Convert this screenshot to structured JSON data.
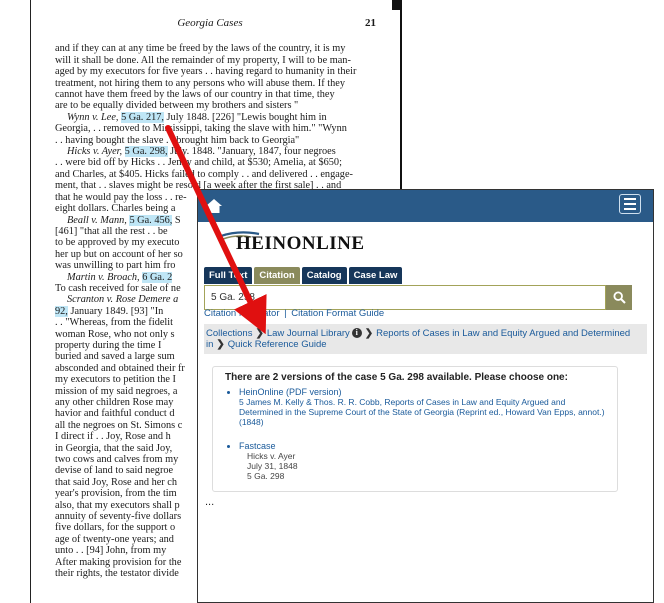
{
  "book_page": {
    "header_title": "Georgia Cases",
    "page_number": "21",
    "lines": [
      "and if they can at any time be freed by the laws of the country, it is my",
      "will it shall be done.  All the remainder of my property, I will to be man-",
      "aged by my executors for five years . . having regard to humanity in their",
      "treatment, not hiring them to any persons who will abuse them.  If they",
      "cannot have them freed by the laws of our country in that time, they",
      "are to be equally divided between my brothers and sisters \""
    ],
    "wynn_case": {
      "name": "Wynn v. Lee,",
      "cite": "5 Ga. 217,",
      "rest": " July 1848.  [226] \"Lewis bought him in"
    },
    "wynn_lines": [
      "Georgia, . . removed to Mississippi, taking the slave with him.\"  \"Wynn",
      ". . having bought the slave . . brought him back to Georgia\""
    ],
    "hicks_case": {
      "name": "Hicks v. Ayer,",
      "cite": "5 Ga. 298,",
      "rest": " July. 1848.  \"January, 1847, four negroes"
    },
    "hicks_lines": [
      ". . were bid off by Hicks . . Jenny and child, at $530; Amelia, at $650;",
      "and Charles, at $405.  Hicks failed to comply . . and delivered . . engage-",
      "ment, that . . slaves might be resold [a week after the first sale] . . and",
      "that he would pay the loss . . re-",
      "eight dollars.  Charles being a"
    ],
    "beall_case": {
      "name": "Beall v. Mann,",
      "cite": "5 Ga. 456,",
      "rest": " S"
    },
    "beall_lines": [
      "[461] \"that all the rest . . be",
      "to be approved by my executo",
      "her up but on account of her so",
      "was unwilling to part him fro"
    ],
    "martin_case": {
      "name": "Martin v. Broach,",
      "cite": "6 Ga. 2"
    },
    "martin_lines": [
      "To cash received for sale of ne"
    ],
    "scranton_case": {
      "name": "Scranton v. Rose Demere a"
    },
    "scranton_first": {
      "cite": "92,",
      "rest": " January 1849.  [93]  \"In"
    },
    "scranton_lines": [
      ". . \"Whereas, from the fidelit",
      "woman Rose, who not only s",
      "property during the time I",
      "buried and saved a large sum",
      "absconded and obtained their fr",
      "my executors to petition the I",
      "mission of my said negroes, a",
      "any other children Rose may",
      "havior and faithful conduct d",
      "all the negroes on St. Simons c",
      "I direct if . . Joy, Rose and h",
      "in Georgia, that the said Joy,",
      "two cows and calves from my",
      "devise of land to said negroe",
      "that said Joy, Rose and her ch",
      "year's provision, from the tim",
      "also, that my executors shall p",
      "annuity of seventy-five dollars",
      "five dollars, for the support o",
      "age of twenty-one years; and",
      "unto . . [94] John, from my",
      "After making provision for the",
      "their rights, the testator divide"
    ]
  },
  "heinonline": {
    "logo_text": "HEINONLINE",
    "tabs": [
      {
        "label": "Full Text",
        "active": false
      },
      {
        "label": "Citation",
        "active": true
      },
      {
        "label": "Catalog",
        "active": false
      },
      {
        "label": "Case Law",
        "active": false
      }
    ],
    "search": {
      "value": "5 Ga. 298"
    },
    "cite_links": {
      "navigator": "Citation Navigator",
      "separator": "|",
      "format_guide": "Citation Format Guide"
    },
    "breadcrumb": {
      "collections": "Collections",
      "library": "Law Journal Library",
      "reports": "Reports of Cases in Law and Equity Argued and Determined in",
      "quick_ref": "Quick Reference Guide"
    },
    "results": {
      "title": "There are 2 versions of the case 5 Ga. 298 available. Please choose one:",
      "v1_link": "HeinOnline (PDF version)",
      "v1_detail": "5 James M. Kelly & Thos. R. R. Cobb, Reports of Cases in Law and Equity Argued and Determined in the Supreme Court of the State of Georgia (Reprint ed., Howard Van Epps, annot.) (1848)",
      "v2_link": "Fastcase",
      "v2_case": "Hicks v. Ayer",
      "v2_date": "July 31, 1848",
      "v2_cite": "5 Ga. 298"
    },
    "ellipsis": "..."
  },
  "colors": {
    "topbar": "#2a5a88",
    "tab_dark": "#16365a",
    "tab_active": "#8a8a5c",
    "link": "#1a5a9a",
    "highlight": "#bfe6f6",
    "arrow": "#e01010"
  },
  "icons": {
    "home": "home-icon",
    "menu": "hamburger-menu-icon",
    "search": "search-icon",
    "info": "info-icon",
    "arrow": "red-arrow"
  }
}
